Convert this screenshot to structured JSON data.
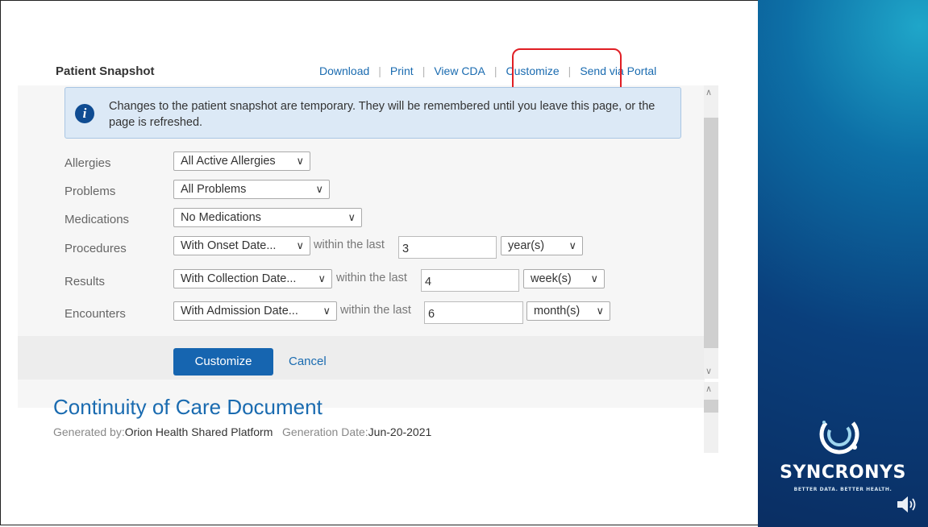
{
  "snapshot": {
    "title": "Patient Snapshot",
    "toolbar": [
      "Download",
      "Print",
      "View CDA",
      "Customize",
      "Send via Portal"
    ],
    "info_message": "Changes to the patient snapshot are temporary. They will be remembered until you leave this page, or the page is refreshed.",
    "within_text": "within the last",
    "rows": [
      {
        "label": "Allergies",
        "select": "All Active Allergies"
      },
      {
        "label": "Problems",
        "select": "All Problems"
      },
      {
        "label": "Medications",
        "select": "No Medications"
      },
      {
        "label": "Procedures",
        "select": "With Onset Date...",
        "number": "3",
        "unit": "year(s)"
      },
      {
        "label": "Results",
        "select": "With Collection Date...",
        "number": "4",
        "unit": "week(s)"
      },
      {
        "label": "Encounters",
        "select": "With Admission Date...",
        "number": "6",
        "unit": "month(s)"
      }
    ],
    "customize_button": "Customize",
    "cancel_link": "Cancel"
  },
  "cda": {
    "title": "Continuity of Care Document",
    "generated_by_label": "Generated by:",
    "generated_by_value": "Orion Health Shared Platform",
    "generation_date_label": "Generation Date:",
    "generation_date_value": "Jun-20-2021"
  },
  "brand": {
    "name": "SYNCRONYS",
    "tagline": "BETTER DATA. BETTER HEALTH."
  },
  "colors": {
    "link": "#1a6bb0",
    "highlight": "#e01e24",
    "button": "#1665b0"
  }
}
